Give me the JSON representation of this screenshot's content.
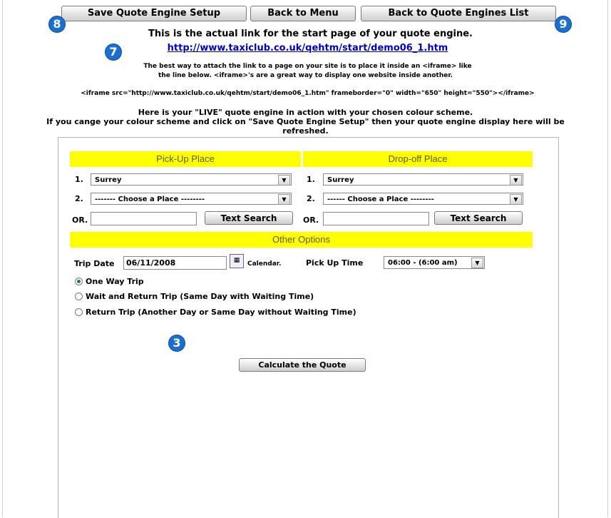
{
  "toolbar": {
    "save_label": "Save Quote Engine Setup",
    "back_menu_label": "Back to Menu",
    "back_list_label": "Back to Quote Engines List"
  },
  "badges": {
    "b8": "8",
    "b9": "9",
    "b7": "7",
    "b3": "3"
  },
  "intro": {
    "heading": "This is the actual link for the start page of your quote engine.",
    "link": "http://www.taxiclub.co.uk/qehtm/start/demo06_1.htm",
    "para1": "The best way to attach the link to a page on your site is to place it inside an <iframe> like",
    "para2": "the line below. <iframe>'s are a great way to display one website inside another.",
    "code": "<iframe src=\"http://www.taxiclub.co.uk/qehtm/start/demo06_1.htm\" frameborder=\"0\" width=\"650\" height=\"550\"></iframe>",
    "live1": "Here is your \"LIVE\" quote engine in action with your chosen colour scheme.",
    "live2": "If you cange your colour scheme and click on \"Save Quote Engine Setup\" then your quote engine display here will be",
    "live3": "refreshed."
  },
  "engine": {
    "pickup_header": "Pick-Up Place",
    "dropoff_header": "Drop-off Place",
    "row1": "1.",
    "row2": "2.",
    "or": "OR.",
    "pickup_sel1": "Surrey",
    "pickup_sel2": "------- Choose a Place --------",
    "dropoff_sel1": "Surrey",
    "dropoff_sel2": "------ Choose a Place --------",
    "text_search": "Text Search",
    "other_header": "Other Options",
    "trip_date_label": "Trip Date",
    "trip_date_value": "06/11/2008",
    "calendar_label": "Calendar.",
    "pickup_time_label": "Pick Up Time",
    "pickup_time_value": "06:00 - (6:00 am)",
    "radio_oneway": "One Way Trip",
    "radio_wait": "Wait and Return Trip (Same Day with Waiting Time)",
    "radio_return": "Return Trip (Another Day or Same Day without Waiting Time)",
    "calculate_label": "Calculate the Quote",
    "selected_trip": "One Way Trip"
  },
  "colors": {
    "header_yellow": "#ffff00",
    "badge_blue": "#1b6fd1",
    "link_blue": "#0000cc"
  },
  "icons": {
    "dropdown": "chevron-down-icon",
    "calendar": "calendar-icon"
  }
}
